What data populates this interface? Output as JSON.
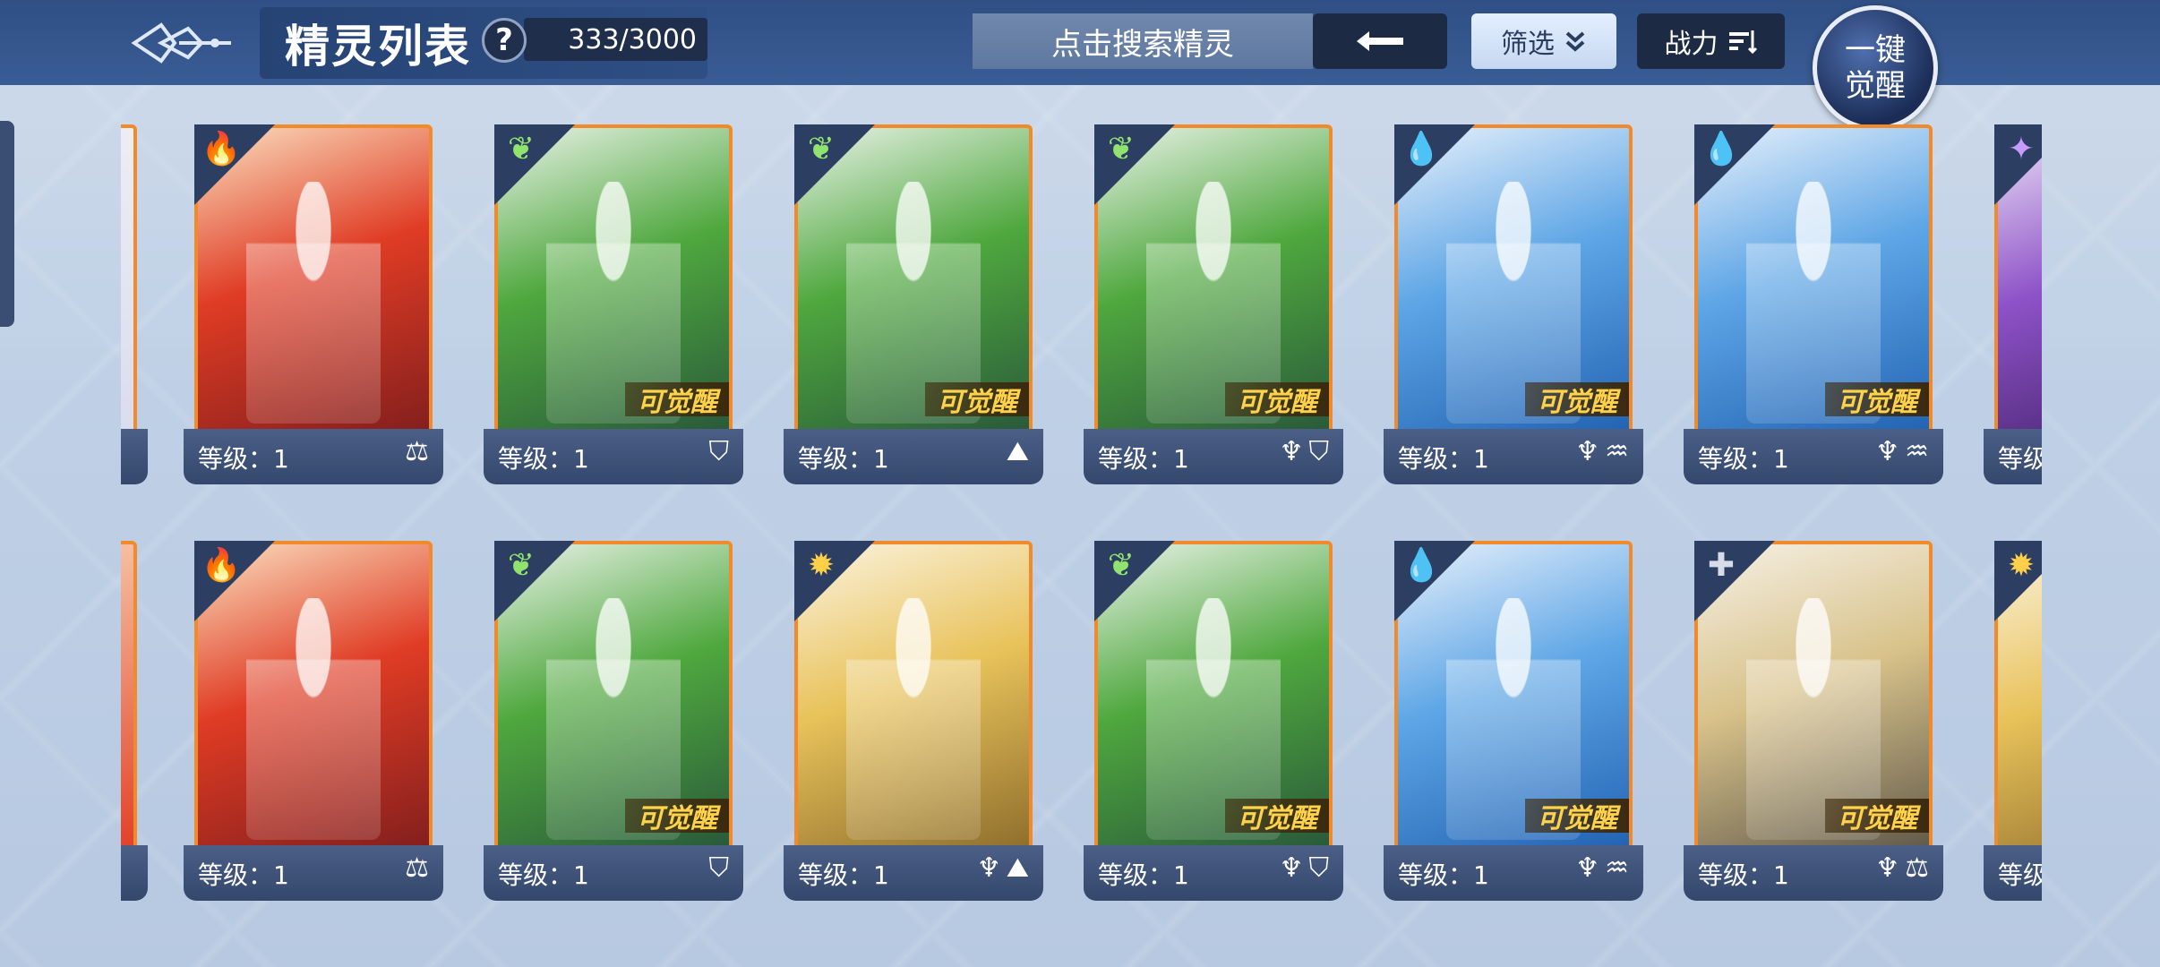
{
  "header": {
    "title": "精灵列表",
    "help_label": "?",
    "count": "333/3000",
    "search_placeholder": "点击搜索精灵",
    "filter_label": "筛选",
    "sort_label": "战力",
    "awaken_all_line1": "一键",
    "awaken_all_line2": "觉醒"
  },
  "colors": {
    "accent_orange": "#f08a2a",
    "header_blue": "#2f4f86"
  },
  "cards_row1": [
    {
      "element": "fire",
      "element_icon": "fire-icon",
      "level": "等级：1",
      "awaken": "",
      "roles": [
        "⚖"
      ]
    },
    {
      "element": "wood",
      "element_icon": "leaf-icon",
      "level": "等级：1",
      "awaken": "可觉醒",
      "roles": [
        "⛉"
      ]
    },
    {
      "element": "wood",
      "element_icon": "leaf-icon",
      "level": "等级：1",
      "awaken": "可觉醒",
      "roles": [
        "⛰"
      ]
    },
    {
      "element": "wood",
      "element_icon": "leaf-icon",
      "level": "等级：1",
      "awaken": "可觉醒",
      "roles": [
        "♆",
        "⛉"
      ]
    },
    {
      "element": "water",
      "element_icon": "water-drop-icon",
      "level": "等级：1",
      "awaken": "可觉醒",
      "roles": [
        "♆",
        "♒"
      ]
    },
    {
      "element": "water",
      "element_icon": "water-drop-icon",
      "level": "等级：1",
      "awaken": "可觉醒",
      "roles": [
        "♆",
        "♒"
      ]
    },
    {
      "element": "purple",
      "element_icon": "dark-icon",
      "level": "等级",
      "awaken": "",
      "roles": []
    }
  ],
  "cards_row2": [
    {
      "element": "fire",
      "element_icon": "fire-icon",
      "level": "等级：1",
      "awaken": "",
      "roles": [
        "⚖"
      ]
    },
    {
      "element": "wood",
      "element_icon": "leaf-icon",
      "level": "等级：1",
      "awaken": "可觉醒",
      "roles": [
        "⛉"
      ]
    },
    {
      "element": "light",
      "element_icon": "sun-icon",
      "level": "等级：1",
      "awaken": "",
      "roles": [
        "♆",
        "⛰"
      ]
    },
    {
      "element": "wood",
      "element_icon": "leaf-icon",
      "level": "等级：1",
      "awaken": "可觉醒",
      "roles": [
        "♆",
        "⛉"
      ]
    },
    {
      "element": "water",
      "element_icon": "water-drop-icon",
      "level": "等级：1",
      "awaken": "可觉醒",
      "roles": [
        "♆",
        "♒"
      ]
    },
    {
      "element": "neutral",
      "element_icon": "cross-icon",
      "level": "等级：1",
      "awaken": "可觉醒",
      "roles": [
        "♆",
        "⚖"
      ]
    },
    {
      "element": "light",
      "element_icon": "sun-icon",
      "level": "等级",
      "awaken": "",
      "roles": []
    }
  ]
}
